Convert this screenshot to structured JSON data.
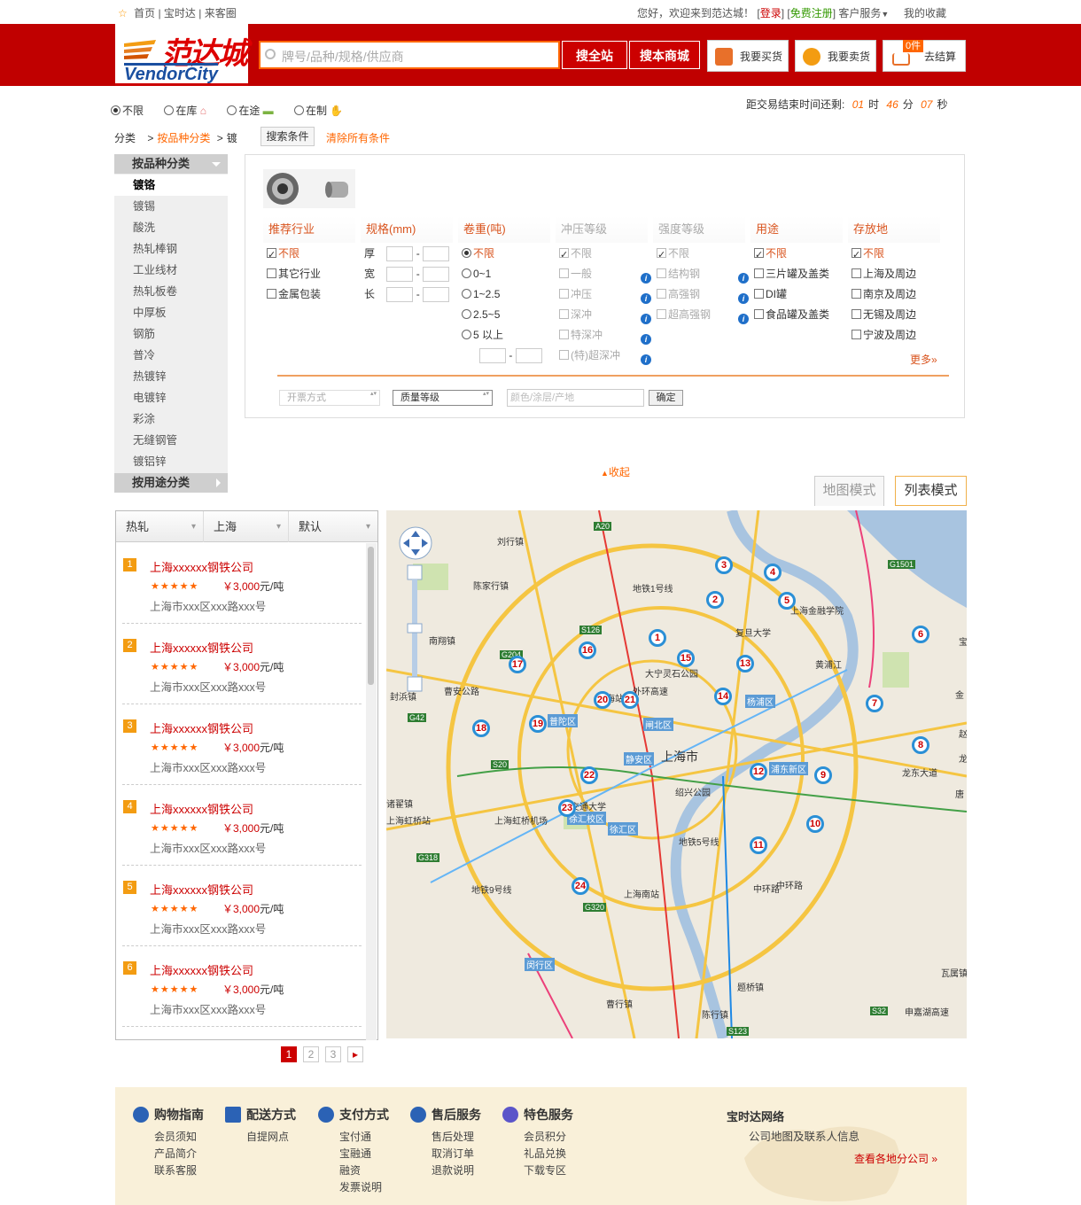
{
  "topbar": {
    "home": "首页",
    "baoshida": "宝时达",
    "laike": "来客圈",
    "welcome": "您好，欢迎来到范达城！",
    "login": "登录",
    "register": "免费注册",
    "service": "客户服务",
    "favorites": "我的收藏"
  },
  "header": {
    "logo_cn": "范达城",
    "logo_en": "VendorCity",
    "search_placeholder": "牌号/品种/规格/供应商",
    "search_all": "搜全站",
    "search_mall": "搜本商城",
    "buy": "我要买货",
    "sell": "我要卖货",
    "cart_count": "0件",
    "checkout": "去结算"
  },
  "stock": {
    "options": [
      "不限",
      "在库",
      "在途",
      "在制"
    ],
    "selected": "不限"
  },
  "timer": {
    "label": "距交易结束时间还剩:",
    "hours": "01",
    "h": "时",
    "minutes": "46",
    "m": "分",
    "seconds": "07",
    "s": "秒"
  },
  "breadcrumb": {
    "root": "分类",
    "level1": "按品种分类",
    "level2": "镀",
    "search_cond": "搜索条件",
    "clear": "清除所有条件"
  },
  "sidebar": {
    "head1": "按品种分类",
    "items": [
      "镀铬",
      "镀锡",
      "酸洗",
      "热轧棒钢",
      "工业线材",
      "热轧板卷",
      "中厚板",
      "钢筋",
      "普冷",
      "热镀锌",
      "电镀锌",
      "彩涂",
      "无缝钢管",
      "镀铝锌"
    ],
    "head2": "按用途分类"
  },
  "filters": {
    "industry": {
      "title": "推荐行业",
      "items": [
        "不限",
        "其它行业",
        "金属包装"
      ]
    },
    "spec": {
      "title": "规格(mm)",
      "thick": "厚",
      "width": "宽",
      "length": "长",
      "dash": "-"
    },
    "coil": {
      "title": "卷重(吨)",
      "items": [
        "不限",
        "0~1",
        "1~2.5",
        "2.5~5",
        "5 以上"
      ],
      "dash": "-"
    },
    "stamp": {
      "title": "冲压等级",
      "items": [
        "不限",
        "一般",
        "冲压",
        "深冲",
        "特深冲",
        "(特)超深冲"
      ]
    },
    "strength": {
      "title": "强度等级",
      "items": [
        "不限",
        "结构钢",
        "高强钢",
        "超高强钢"
      ]
    },
    "usage": {
      "title": "用途",
      "items": [
        "不限",
        "三片罐及盖类",
        "DI罐",
        "食品罐及盖类"
      ]
    },
    "storage": {
      "title": "存放地",
      "items": [
        "不限",
        "上海及周边",
        "南京及周边",
        "无锡及周边",
        "宁波及周边"
      ]
    },
    "more": "更多»",
    "invoice": "开票方式",
    "quality": "质量等级",
    "attr_placeholder": "颜色/涂层/产地",
    "confirm": "确定"
  },
  "collapse": "收起",
  "modes": {
    "map": "地图模式",
    "list": "列表模式"
  },
  "list": {
    "sort": [
      "热轧",
      "上海",
      "默认"
    ],
    "items": [
      {
        "no": "1",
        "name": "上海xxxxxx钢铁公司",
        "stars": "★★★★★",
        "price": "￥3,000",
        "unit": "元/吨",
        "addr": "上海市xxx区xxx路xxx号"
      },
      {
        "no": "2",
        "name": "上海xxxxxx钢铁公司",
        "stars": "★★★★★",
        "price": "￥3,000",
        "unit": "元/吨",
        "addr": "上海市xxx区xxx路xxx号"
      },
      {
        "no": "3",
        "name": "上海xxxxxx钢铁公司",
        "stars": "★★★★★",
        "price": "￥3,000",
        "unit": "元/吨",
        "addr": "上海市xxx区xxx路xxx号"
      },
      {
        "no": "4",
        "name": "上海xxxxxx钢铁公司",
        "stars": "★★★★★",
        "price": "￥3,000",
        "unit": "元/吨",
        "addr": "上海市xxx区xxx路xxx号"
      },
      {
        "no": "5",
        "name": "上海xxxxxx钢铁公司",
        "stars": "★★★★★",
        "price": "￥3,000",
        "unit": "元/吨",
        "addr": "上海市xxx区xxx路xxx号"
      },
      {
        "no": "6",
        "name": "上海xxxxxx钢铁公司",
        "stars": "★★★★★",
        "price": "￥3,000",
        "unit": "元/吨",
        "addr": "上海市xxx区xxx路xxx号"
      }
    ]
  },
  "pagination": {
    "pages": [
      "1",
      "2",
      "3"
    ],
    "current": "1",
    "next": "▸"
  },
  "map": {
    "labels": [
      "刘行镇",
      "陈家行镇",
      "南翔镇",
      "封浜镇",
      "诸翟镇",
      "上海虹桥站",
      "上海虹桥机场",
      "普陀区",
      "静安区",
      "闸北区",
      "上海市",
      "徐汇区",
      "上海南站",
      "闵行区",
      "曹行镇",
      "陈行镇",
      "题桥镇",
      "浦东新区",
      "杨浦区",
      "复旦大学",
      "上海金融学院",
      "大宁灵石公园",
      "绍兴公园",
      "黄浦江",
      "龙东大道",
      "瓦属镇",
      "申嘉湖高速",
      "中环路",
      "地铁1号线",
      "地铁9号线",
      "地铁5号线",
      "交通大学",
      "上海站",
      "徐汇校区",
      "曹安公路",
      "外环高速",
      "中环路",
      "A20",
      "S20",
      "G1501",
      "S126",
      "G204",
      "G42",
      "G318",
      "G320",
      "S32",
      "S123",
      "宝钢",
      "金",
      "唐",
      "龙",
      "赵"
    ],
    "markers": [
      "1",
      "2",
      "3",
      "4",
      "5",
      "6",
      "7",
      "8",
      "9",
      "10",
      "11",
      "12",
      "13",
      "14",
      "15",
      "16",
      "17",
      "18",
      "19",
      "20",
      "21",
      "22",
      "23",
      "24"
    ]
  },
  "footer": {
    "guide": {
      "title": "购物指南",
      "items": [
        "会员须知",
        "产品简介",
        "联系客服"
      ]
    },
    "delivery": {
      "title": "配送方式",
      "items": [
        "自提网点"
      ]
    },
    "payment": {
      "title": "支付方式",
      "items": [
        "宝付通",
        "宝融通",
        "融资",
        "发票说明"
      ]
    },
    "after": {
      "title": "售后服务",
      "items": [
        "售后处理",
        "取消订单",
        "退款说明"
      ]
    },
    "special": {
      "title": "特色服务",
      "items": [
        "会员积分",
        "礼品兑换",
        "下载专区"
      ]
    },
    "network": {
      "title": "宝时达网络",
      "desc": "公司地图及联系人信息",
      "link": "查看各地分公司 »"
    }
  }
}
